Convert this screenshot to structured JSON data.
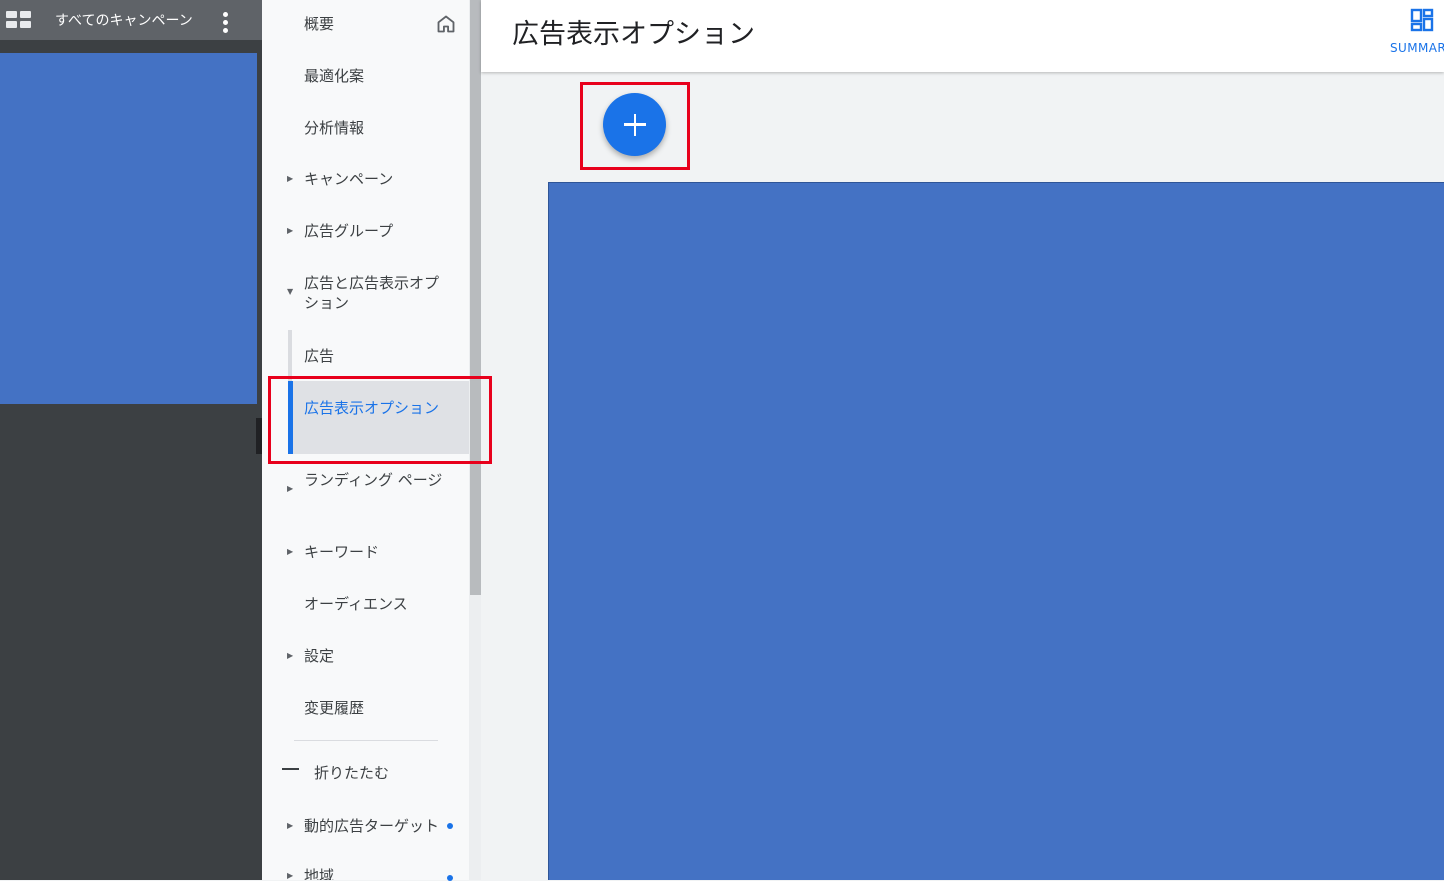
{
  "account": {
    "title": "すべてのキャンペーン"
  },
  "nav": {
    "items": [
      {
        "label": "概要"
      },
      {
        "label": "最適化案"
      },
      {
        "label": "分析情報"
      },
      {
        "label": "キャンペーン"
      },
      {
        "label": "広告グループ"
      },
      {
        "label": "広告と広告表示オプション"
      },
      {
        "label": "広告"
      },
      {
        "label": "広告表示オプション"
      },
      {
        "label": "ランディング ページ"
      },
      {
        "label": "キーワード"
      },
      {
        "label": "オーディエンス"
      },
      {
        "label": "設定"
      },
      {
        "label": "変更履歴"
      },
      {
        "label": "折りたたむ"
      },
      {
        "label": "動的広告ターゲット"
      },
      {
        "label": "地域"
      }
    ]
  },
  "main": {
    "title": "広告表示オプション",
    "summary_label": "SUMMARY"
  },
  "colors": {
    "accent": "#1a73e8",
    "highlight": "#e8001c",
    "placeholder_blue": "#4472c4",
    "dark_panel": "#3c4043"
  }
}
